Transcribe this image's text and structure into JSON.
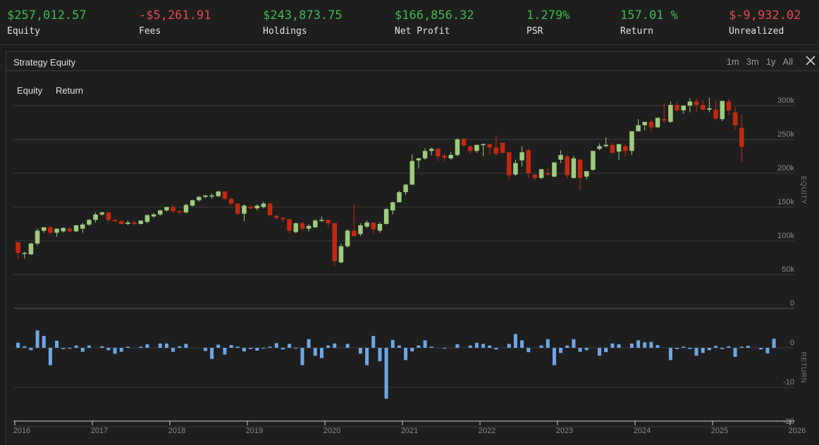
{
  "stats": [
    {
      "value": "$257,012.57",
      "label": "Equity",
      "color": "#3fb950"
    },
    {
      "value": "-$5,261.91",
      "label": "Fees",
      "color": "#e5484d"
    },
    {
      "value": "$243,873.75",
      "label": "Holdings",
      "color": "#3fb950"
    },
    {
      "value": "$166,856.32",
      "label": "Net Profit",
      "color": "#3fb950"
    },
    {
      "value": "1.279%",
      "label": "PSR",
      "color": "#3fb950"
    },
    {
      "value": "157.01 %",
      "label": "Return",
      "color": "#3fb950"
    },
    {
      "value": "$-9,932.02",
      "label": "Unrealized",
      "color": "#e5484d"
    }
  ],
  "panel": {
    "title": "Strategy Equity",
    "ranges": [
      "1m",
      "3m",
      "1y",
      "All"
    ],
    "close_icon": "close-icon"
  },
  "legend": {
    "equity": "Equity",
    "return": "Return"
  },
  "colors": {
    "up": "#9ecb7d",
    "down": "#c4290f",
    "return_bar": "#6ea7e6",
    "grid": "#3a3a3a"
  },
  "chart_data": [
    {
      "type": "candlestick",
      "title": "Equity",
      "ylabel": "EQUITY",
      "ylim": [
        0,
        300000
      ],
      "yticks": [
        "0",
        "50k",
        "100k",
        "150k",
        "200k",
        "250k",
        "300k"
      ],
      "x_start": 2016.0,
      "x_step_months": 1,
      "series": [
        {
          "name": "Equity",
          "ohlc": [
            [
              98000,
              98000,
              73000,
              82000
            ],
            [
              82000,
              84000,
              74000,
              82000
            ],
            [
              80000,
              97000,
              79000,
              96000
            ],
            [
              96000,
              118000,
              93000,
              115000
            ],
            [
              115000,
              120000,
              112000,
              120000
            ],
            [
              120000,
              122000,
              110000,
              112000
            ],
            [
              112000,
              118000,
              106000,
              118000
            ],
            [
              114000,
              120000,
              112000,
              119000
            ],
            [
              118000,
              121000,
              112000,
              114000
            ],
            [
              114000,
              123000,
              113000,
              123000
            ],
            [
              118000,
              127000,
              112000,
              124000
            ],
            [
              124000,
              132000,
              122000,
              131000
            ],
            [
              131000,
              142000,
              127000,
              139000
            ],
            [
              139000,
              143000,
              137000,
              142000
            ],
            [
              142000,
              142000,
              128000,
              131000
            ],
            [
              131000,
              132000,
              128000,
              129000
            ],
            [
              129000,
              130000,
              124000,
              125000
            ],
            [
              125000,
              130000,
              123000,
              127000
            ],
            [
              127000,
              130000,
              122000,
              125000
            ],
            [
              125000,
              130000,
              124000,
              130000
            ],
            [
              128000,
              139000,
              126000,
              138000
            ],
            [
              136000,
              141000,
              134000,
              139000
            ],
            [
              139000,
              146000,
              137000,
              145000
            ],
            [
              145000,
              150000,
              143000,
              150000
            ],
            [
              150000,
              153000,
              141000,
              144000
            ],
            [
              144000,
              145000,
              139000,
              142000
            ],
            [
              142000,
              155000,
              141000,
              153000
            ],
            [
              152000,
              161000,
              151000,
              160000
            ],
            [
              160000,
              166000,
              158000,
              165000
            ],
            [
              165000,
              168000,
              163000,
              167000
            ],
            [
              166000,
              170000,
              162000,
              167000
            ],
            [
              166000,
              174000,
              165000,
              173000
            ],
            [
              173000,
              173000,
              161000,
              162000
            ],
            [
              162000,
              164000,
              153000,
              155000
            ],
            [
              155000,
              155000,
              138000,
              140000
            ],
            [
              140000,
              154000,
              129000,
              152000
            ],
            [
              150000,
              153000,
              147000,
              148000
            ],
            [
              148000,
              154000,
              145000,
              152000
            ],
            [
              150000,
              158000,
              148000,
              155000
            ],
            [
              155000,
              157000,
              136000,
              138000
            ],
            [
              137000,
              138000,
              131000,
              134000
            ],
            [
              134000,
              135000,
              127000,
              132000
            ],
            [
              132000,
              132000,
              111000,
              115000
            ],
            [
              113000,
              127000,
              111000,
              126000
            ],
            [
              126000,
              128000,
              115000,
              118000
            ],
            [
              118000,
              125000,
              114000,
              122000
            ],
            [
              120000,
              132000,
              119000,
              130000
            ],
            [
              130000,
              136000,
              128000,
              131000
            ],
            [
              131000,
              131000,
              121000,
              126000
            ],
            [
              126000,
              126000,
              63000,
              70000
            ],
            [
              68000,
              96000,
              67000,
              92000
            ],
            [
              92000,
              117000,
              90000,
              115000
            ],
            [
              115000,
              154000,
              107000,
              107000
            ],
            [
              110000,
              126000,
              107000,
              123000
            ],
            [
              121000,
              130000,
              119000,
              127000
            ],
            [
              127000,
              127000,
              111000,
              117000
            ],
            [
              115000,
              128000,
              112000,
              125000
            ],
            [
              125000,
              148000,
              124000,
              147000
            ],
            [
              145000,
              158000,
              139000,
              157000
            ],
            [
              157000,
              174000,
              157000,
              172000
            ],
            [
              172000,
              184000,
              168000,
              183000
            ],
            [
              183000,
              228000,
              183000,
              218000
            ],
            [
              219000,
              223000,
              207000,
              222000
            ],
            [
              222000,
              237000,
              220000,
              233000
            ],
            [
              233000,
              238000,
              226000,
              236000
            ],
            [
              236000,
              237000,
              218000,
              225000
            ],
            [
              226000,
              229000,
              218000,
              223000
            ],
            [
              222000,
              231000,
              220000,
              227000
            ],
            [
              227000,
              252000,
              225000,
              250000
            ],
            [
              251000,
              252000,
              240000,
              241000
            ],
            [
              240000,
              241000,
              228000,
              233000
            ],
            [
              233000,
              241000,
              230000,
              242000
            ],
            [
              242000,
              244000,
              225000,
              243000
            ],
            [
              243000,
              243000,
              227000,
              238000
            ],
            [
              238000,
              256000,
              226000,
              229000
            ],
            [
              245000,
              245000,
              230000,
              230000
            ],
            [
              231000,
              231000,
              190000,
              197000
            ],
            [
              198000,
              220000,
              196000,
              215000
            ],
            [
              219000,
              240000,
              210000,
              231000
            ],
            [
              234000,
              237000,
              193000,
              200000
            ],
            [
              198000,
              196000,
              190000,
              193000
            ],
            [
              193000,
              205000,
              191000,
              206000
            ],
            [
              200000,
              208000,
              196000,
              198000
            ],
            [
              195000,
              215000,
              194000,
              216000
            ],
            [
              220000,
              234000,
              215000,
              227000
            ],
            [
              225000,
              227000,
              192000,
              197000
            ],
            [
              193000,
              226000,
              192000,
              222000
            ],
            [
              220000,
              222000,
              175000,
              193000
            ],
            [
              195000,
              203000,
              191000,
              203000
            ],
            [
              205000,
              233000,
              204000,
              233000
            ],
            [
              236000,
              244000,
              234000,
              240000
            ],
            [
              240000,
              253000,
              238000,
              242000
            ],
            [
              242000,
              245000,
              233000,
              230000
            ],
            [
              232000,
              240000,
              220000,
              243000
            ],
            [
              240000,
              243000,
              225000,
              233000
            ],
            [
              233000,
              260000,
              227000,
              262000
            ],
            [
              262000,
              280000,
              262000,
              271000
            ],
            [
              271000,
              274000,
              263000,
              276000
            ],
            [
              276000,
              279000,
              262000,
              268000
            ],
            [
              268000,
              281000,
              267000,
              282000
            ],
            [
              280000,
              303000,
              274000,
              278000
            ],
            [
              276000,
              306000,
              274000,
              301000
            ],
            [
              301000,
              306000,
              290000,
              293000
            ],
            [
              293000,
              298000,
              288000,
              300000
            ],
            [
              300000,
              311000,
              290000,
              306000
            ],
            [
              306000,
              311000,
              290000,
              301000
            ],
            [
              301000,
              308000,
              293000,
              294000
            ],
            [
              294000,
              312000,
              290000,
              296000
            ],
            [
              294000,
              308000,
              278000,
              281000
            ],
            [
              280000,
              307000,
              277000,
              307000
            ],
            [
              306000,
              310000,
              286000,
              293000
            ],
            [
              290000,
              298000,
              265000,
              271000
            ],
            [
              267000,
              287000,
              217000,
              239000
            ]
          ]
        }
      ]
    },
    {
      "type": "bar",
      "title": "Return",
      "ylabel": "RETURN",
      "ylim": [
        -20,
        5
      ],
      "yticks": [
        "0",
        "-10",
        "-20"
      ],
      "xticks": [
        "2016",
        "2017",
        "2018",
        "2019",
        "2020",
        "2021",
        "2022",
        "2023",
        "2024",
        "2025",
        "2026"
      ],
      "series": [
        {
          "name": "Return",
          "values": [
            1.3,
            0.4,
            -0.6,
            4.4,
            3.0,
            -4.4,
            1.8,
            -0.3,
            -0.2,
            0.6,
            -1.0,
            0.6,
            0,
            0.4,
            -0.6,
            -1.5,
            -1.0,
            0.3,
            0,
            0.3,
            0.9,
            0,
            1.1,
            1.1,
            -1.0,
            0.4,
            1.0,
            0,
            0,
            -0.8,
            -2.8,
            0.8,
            -1.7,
            0.7,
            0.3,
            -0.9,
            -0.3,
            -0.7,
            -0.2,
            0.3,
            1.2,
            -0.4,
            1.0,
            -0.2,
            -4.4,
            2.2,
            -2.0,
            -2.6,
            0.6,
            1.1,
            0,
            1.0,
            0,
            -1.5,
            -4.4,
            3.0,
            -3.4,
            -12.9,
            2.0,
            0.6,
            -3.1,
            -0.9,
            0.6,
            1.9,
            0.3,
            0,
            -0.2,
            0,
            0.9,
            0,
            0.6,
            1.3,
            1.0,
            0.6,
            -0.4,
            0,
            1.0,
            3.5,
            1.9,
            -1.1,
            0,
            0.6,
            2.2,
            -4.4,
            -1.3,
            0.6,
            2.2,
            -1.0,
            -0.6,
            0,
            -2.0,
            -1.1,
            1.1,
            0.9,
            0,
            1.1,
            1.9,
            1.4,
            1.5,
            0.7,
            0,
            -3.1,
            -0.3,
            0.3,
            -0.3,
            -2.0,
            -1.3,
            -0.6,
            0.5,
            -0.3,
            0.4,
            -2.3,
            0.3,
            0.5,
            0,
            -0.4,
            -1.4,
            2.3
          ]
        }
      ]
    }
  ]
}
